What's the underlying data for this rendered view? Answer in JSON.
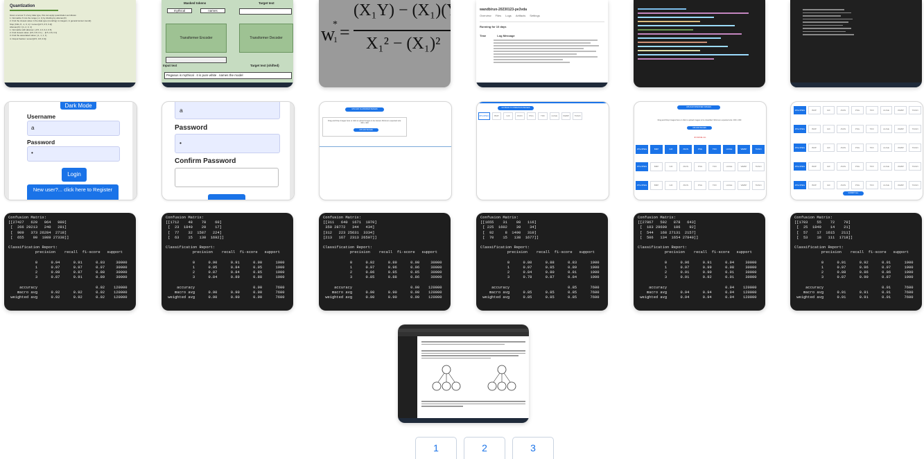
{
  "row1": {
    "quantization": {
      "title": "Quantization",
      "lines": [
        "Given a tensor X of any data type, this can apply quantization as follows:",
        "1. Normalize X into the range [-1, 1] by dividing by absmax(X)",
        "2. Find the closest value in the data type (rounding) to integers; in general tensor.round()",
        "Stop (Xdiv, 8, -1, 0, 1) = tensor([-0.5, 0.5, 0.2])",
        "Absmax(X) = [1, 2, 3, 4]",
        "1. Normalize with absmax: [-0.5, 1.0, 0.2, 0.5]",
        "2. Find closest value: [0.5, 0.8, 0.1] ... [0.5, 0.8, 0.1]",
        "3. Find the associated value: [-1, 1, 1, 1]",
        "4. Output fraction: tensor([0.5, 0.8, 0.9])"
      ]
    },
    "transformer": {
      "masked_tokens": "Masked tokens",
      "target_text": "Target text",
      "token_mythical": "mythical",
      "token_names": "names",
      "encoder": "Transformer Encoder",
      "decoder": "Transformer Decoder",
      "input_text": "Input text",
      "target_shifted": "Target text (shifted)",
      "bottom_text": "Pegasus is mythical . it is pure white . names the model"
    },
    "formula": {
      "lhs": "w",
      "sub": "1",
      "sup": "*",
      "num": "(X₁Y) − (X₁)(Y)",
      "den": "X₁² − (X₁)²"
    },
    "notebook": {
      "header": "wandb/run-20230123-pe3vda",
      "tabs": [
        "Overview",
        "Files",
        "Logs",
        "Artifacts",
        "Settings"
      ],
      "section": "Running for 10 days",
      "col1": "Time",
      "col2": "Log Message"
    }
  },
  "row2": {
    "dark_mode_label": "Dark Mode",
    "username_label": "Username",
    "username_value": "a",
    "password_label": "Password",
    "password_value": "•",
    "login_label": "Login",
    "new_user_label": "New user?... click here to Register",
    "reg_username_value": "a",
    "reg_password_label": "Password",
    "reg_password_value": "•",
    "confirm_password_label": "Confirm Password",
    "upload_classified": "UPLOAD CLASSIFIED IMAGES",
    "drag_drop": "Drag and Drop Images here or click to upload images to be trained, Minimum expected size: 300 x 300",
    "upload_images": "UPLOAD IMAGES",
    "go_back": "GO BACK TO PREVIOUS IMAGES",
    "formats": [
      "JPG/JPEG",
      "BMP",
      "GIF",
      "JSON",
      "PNG",
      "TIFF",
      "HUGE",
      "WEBP",
      "TRAIN"
    ],
    "upload_specified": "UPLOAD SPECIFIED IMAGES",
    "drag_drop2": "Drag and Drop Images here or click to upload images to be classified. Minimum expected size: 300 x 300",
    "submit": "SUBMIT ALL"
  },
  "row3": [
    {
      "matrix": "Confusion Matrix:\n[[27427   620   964   989]\n [  266 29213   240   281]\n [  909   373 26284  2718]\n [  655    90  1089 27338]]",
      "rows": [
        [
          "0",
          "0.94",
          "0.91",
          "0.93",
          "30000"
        ],
        [
          "1",
          "0.97",
          "0.97",
          "0.97",
          "30000"
        ],
        [
          "2",
          "0.89",
          "0.87",
          "0.88",
          "30000"
        ],
        [
          "3",
          "0.87",
          "0.91",
          "0.89",
          "30000"
        ]
      ],
      "acc": [
        "0.92",
        "120000"
      ],
      "macro": [
        "0.92",
        "0.92",
        "0.92",
        "120000"
      ],
      "weighted": [
        "0.92",
        "0.92",
        "0.92",
        "120000"
      ]
    },
    {
      "matrix": "Confusion Matrix:\n[[1712    48    78    60]\n [  23  1840    20    17]\n [  77    32  1587   224]\n [  63    15   130  1692]]",
      "rows": [
        [
          "0",
          "0.90",
          "0.91",
          "0.90",
          "1900"
        ],
        [
          "1",
          "0.95",
          "0.84",
          "0.95",
          "1900"
        ],
        [
          "2",
          "0.87",
          "0.84",
          "0.85",
          "1900"
        ],
        [
          "3",
          "0.84",
          "0.89",
          "0.88",
          "1900"
        ]
      ],
      "acc": [
        "0.90",
        "7600"
      ],
      "macro": [
        "0.90",
        "0.90",
        "0.90",
        "7600"
      ],
      "weighted": [
        "0.90",
        "0.90",
        "0.90",
        "7600"
      ]
    },
    {
      "matrix": "Confusion Matrix:\n[[311   640  1671  1070]\n 350 28772   344   434]\n[312   223 25631  3334]\n[213   167  2313 26507]]",
      "rows": [
        [
          "0",
          "0.92",
          "0.89",
          "0.90",
          "30000"
        ],
        [
          "1",
          "0.97",
          "0.96",
          "0.96",
          "30000"
        ],
        [
          "2",
          "0.86",
          "0.85",
          "0.85",
          "30000"
        ],
        [
          "3",
          "0.85",
          "0.88",
          "0.86",
          "30000"
        ]
      ],
      "acc": [
        "0.90",
        "120000"
      ],
      "macro": [
        "0.90",
        "0.90",
        "0.90",
        "120000"
      ],
      "weighted": [
        "0.90",
        "0.90",
        "0.90",
        "120000"
      ]
    },
    {
      "matrix": "Confusion Matrix:\n[[1655    31    98   116]\n [ 225  1602    39    34]\n [  92     8  1490   310]\n [  70    15   138  1677]]",
      "rows": [
        [
          "0",
          "0.80",
          "0.88",
          "0.83",
          "1900"
        ],
        [
          "1",
          "0.97",
          "0.85",
          "0.89",
          "1900"
        ],
        [
          "2",
          "0.84",
          "0.80",
          "0.81",
          "1900"
        ],
        [
          "3",
          "0.78",
          "0.87",
          "0.84",
          "1900"
        ]
      ],
      "acc": [
        "0.85",
        "7600"
      ],
      "macro": [
        "0.85",
        "0.85",
        "0.85",
        "7600"
      ],
      "weighted": [
        "0.85",
        "0.85",
        "0.85",
        "7600"
      ]
    },
    {
      "matrix": "Confusion Matrix:\n[[27867   592   878   643]\n [  103 29690   106    92]\n [  544   168 27131  2157]\n [  506   134  1654 27840]]",
      "rows": [
        [
          "0",
          "0.96",
          "0.91",
          "0.94",
          "30000"
        ],
        [
          "1",
          "0.97",
          "0.99",
          "0.98",
          "30000"
        ],
        [
          "2",
          "0.91",
          "0.90",
          "0.91",
          "30000"
        ],
        [
          "3",
          "0.91",
          "0.92",
          "0.91",
          "30000"
        ]
      ],
      "acc": [
        "0.94",
        "120000"
      ],
      "macro": [
        "0.94",
        "0.94",
        "0.94",
        "120000"
      ],
      "weighted": [
        "0.94",
        "0.94",
        "0.94",
        "120000"
      ]
    },
    {
      "matrix": "Confusion Matrix:\n[[1703    55    72    70]\n [  25  1849    14    21]\n [  57    17  1615   211]\n [  53    18   111  1718]]",
      "rows": [
        [
          "0",
          "0.91",
          "0.92",
          "0.91",
          "1900"
        ],
        [
          "1",
          "0.97",
          "0.96",
          "0.97",
          "1900"
        ],
        [
          "2",
          "0.88",
          "0.86",
          "0.86",
          "1900"
        ],
        [
          "3",
          "0.87",
          "0.90",
          "0.87",
          "1900"
        ]
      ],
      "acc": [
        "0.91",
        "7600"
      ],
      "macro": [
        "0.91",
        "0.91",
        "0.91",
        "7600"
      ],
      "weighted": [
        "0.91",
        "0.91",
        "0.91",
        "7600"
      ]
    }
  ],
  "report": {
    "title": "Classification Report:",
    "headers": [
      "precision",
      "recall",
      "f1-score",
      "support"
    ],
    "accuracy": "accuracy",
    "macro": "macro avg",
    "weighted": "weighted avg"
  },
  "pagination": [
    "1",
    "2",
    "3"
  ],
  "colors": {
    "accent": "#1a73e8",
    "terminal": "#1e1e1e",
    "transformer_bg": "#c6dcc1"
  }
}
